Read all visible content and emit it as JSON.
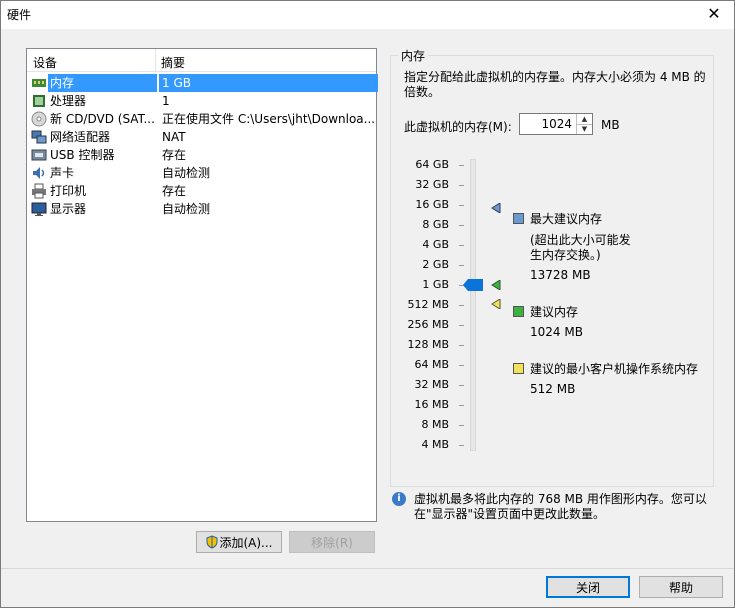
{
  "window": {
    "title": "硬件",
    "close_glyph": "✕"
  },
  "devices": {
    "col_device": "设备",
    "col_summary": "摘要",
    "rows": [
      {
        "name": "内存",
        "summary": "1 GB",
        "icon": "memory-icon"
      },
      {
        "name": "处理器",
        "summary": "1",
        "icon": "processor-icon"
      },
      {
        "name": "新 CD/DVD (SAT...",
        "summary": "正在使用文件 C:\\Users\\jht\\Downloa...",
        "icon": "cd-icon"
      },
      {
        "name": "网络适配器",
        "summary": "NAT",
        "icon": "network-icon"
      },
      {
        "name": "USB 控制器",
        "summary": "存在",
        "icon": "usb-icon"
      },
      {
        "name": "声卡",
        "summary": "自动检测",
        "icon": "sound-icon"
      },
      {
        "name": "打印机",
        "summary": "存在",
        "icon": "printer-icon"
      },
      {
        "name": "显示器",
        "summary": "自动检测",
        "icon": "display-icon"
      }
    ],
    "add_label": "添加(A)...",
    "remove_label": "移除(R)"
  },
  "memory": {
    "group_label": "内存",
    "description": "指定分配给此虚拟机的内存量。内存大小必须为 4 MB 的倍数。",
    "field_label": "此虚拟机的内存(M):",
    "value": "1024",
    "unit": "MB",
    "scale": [
      "64 GB",
      "32 GB",
      "16 GB",
      "8 GB",
      "4 GB",
      "2 GB",
      "1 GB",
      "512 MB",
      "256 MB",
      "128 MB",
      "64 MB",
      "32 MB",
      "16 MB",
      "8 MB",
      "4 MB"
    ],
    "slider_value": "1 GB",
    "legend": {
      "max_label": "最大建议内存",
      "max_note": "(超出此大小可能发生内存交换。)",
      "max_value": "13728 MB",
      "rec_label": "建议内存",
      "rec_value": "1024 MB",
      "min_label": "建议的最小客户机操作系统内存",
      "min_value": "512 MB"
    },
    "colors": {
      "max": "#6a9ad0",
      "rec": "#3cb23c",
      "min": "#f2e25a",
      "thumb": "#0a74da"
    },
    "info": "虚拟机最多将此内存的 768 MB 用作图形内存。您可以在\"显示器\"设置页面中更改此数量。"
  },
  "footer": {
    "close_label": "关闭",
    "help_label": "帮助"
  }
}
